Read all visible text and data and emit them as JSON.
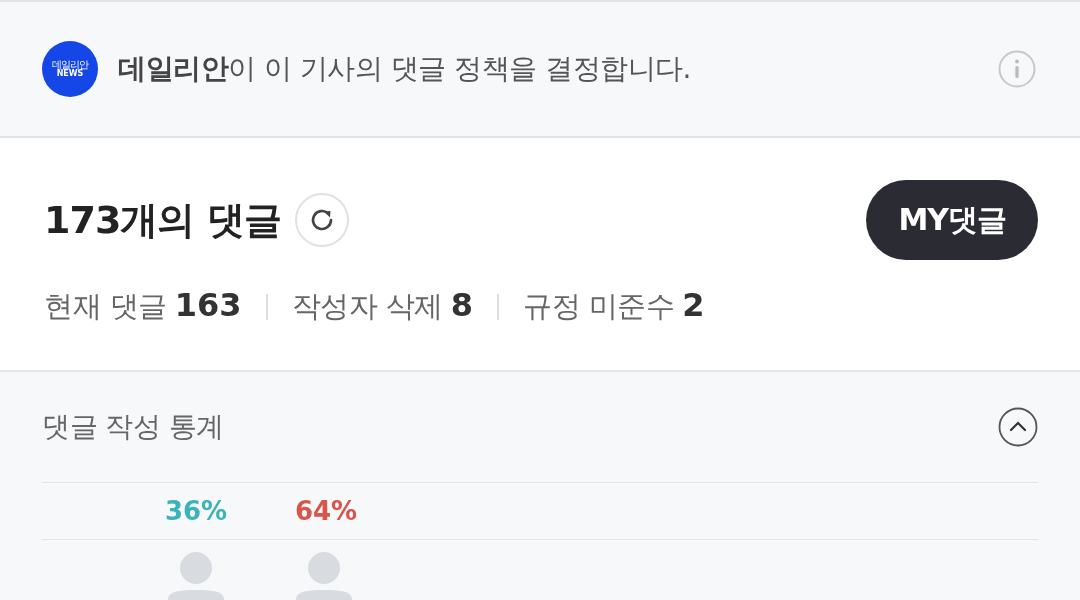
{
  "policy_banner": {
    "logo": {
      "name": "데일리안",
      "sub": "NEWS"
    },
    "text": "**데일리안**이 이 기사의 댓글 정책을 결정합니다."
  },
  "comments_header": {
    "title": "173개의 댓글",
    "my_button": "MY댓글",
    "stats": [
      {
        "label": "현재 댓글",
        "value": "163"
      },
      {
        "label": "작성자 삭제",
        "value": "8"
      },
      {
        "label": "규정 미준수",
        "value": "2"
      }
    ]
  },
  "statistics": {
    "title": "댓글 작성 통계",
    "expanded": true,
    "groups": [
      {
        "percent": "36%",
        "color": "#3bb3b8"
      },
      {
        "percent": "64%",
        "color": "#d9544a"
      }
    ]
  }
}
